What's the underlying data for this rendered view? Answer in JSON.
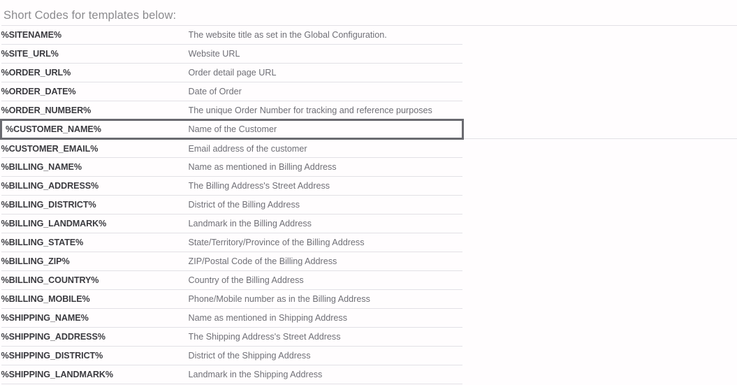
{
  "panel": {
    "heading": "Short Codes for templates below:"
  },
  "table": {
    "rows": [
      {
        "code": "%SITENAME%",
        "description": "The website title as set in the Global Configuration.",
        "focused": false
      },
      {
        "code": "%SITE_URL%",
        "description": "Website URL",
        "focused": false
      },
      {
        "code": "%ORDER_URL%",
        "description": "Order detail page URL",
        "focused": false
      },
      {
        "code": "%ORDER_DATE%",
        "description": "Date of Order",
        "focused": false
      },
      {
        "code": "%ORDER_NUMBER%",
        "description": "The unique Order Number for tracking and reference purposes",
        "focused": false
      },
      {
        "code": "%CUSTOMER_NAME%",
        "description": "Name of the Customer",
        "focused": true
      },
      {
        "code": "%CUSTOMER_EMAIL%",
        "description": "Email address of the customer",
        "focused": false
      },
      {
        "code": "%BILLING_NAME%",
        "description": "Name as mentioned in Billing Address",
        "focused": false
      },
      {
        "code": "%BILLING_ADDRESS%",
        "description": "The Billing Address's Street Address",
        "focused": false
      },
      {
        "code": "%BILLING_DISTRICT%",
        "description": "District of the Billing Address",
        "focused": false
      },
      {
        "code": "%BILLING_LANDMARK%",
        "description": "Landmark in the Billing Address",
        "focused": false
      },
      {
        "code": "%BILLING_STATE%",
        "description": "State/Territory/Province of the Billing Address",
        "focused": false
      },
      {
        "code": "%BILLING_ZIP%",
        "description": "ZIP/Postal Code of the Billing Address",
        "focused": false
      },
      {
        "code": "%BILLING_COUNTRY%",
        "description": "Country of the Billing Address",
        "focused": false
      },
      {
        "code": "%BILLING_MOBILE%",
        "description": "Phone/Mobile number as in the Billing Address",
        "focused": false
      },
      {
        "code": "%SHIPPING_NAME%",
        "description": "Name as mentioned in Shipping Address",
        "focused": false
      },
      {
        "code": "%SHIPPING_ADDRESS%",
        "description": "The Shipping Address's Street Address",
        "focused": false
      },
      {
        "code": "%SHIPPING_DISTRICT%",
        "description": "District of the Shipping Address",
        "focused": false
      },
      {
        "code": "%SHIPPING_LANDMARK%",
        "description": "Landmark in the Shipping Address",
        "focused": false
      }
    ]
  },
  "colors": {
    "page_background": "#fffdfe",
    "heading_text": "#8b8b8e",
    "code_text": "#3b3b40",
    "description_text": "#6f6f76",
    "row_border": "#e2e1e6",
    "focus_outline": "#6a6a70"
  }
}
